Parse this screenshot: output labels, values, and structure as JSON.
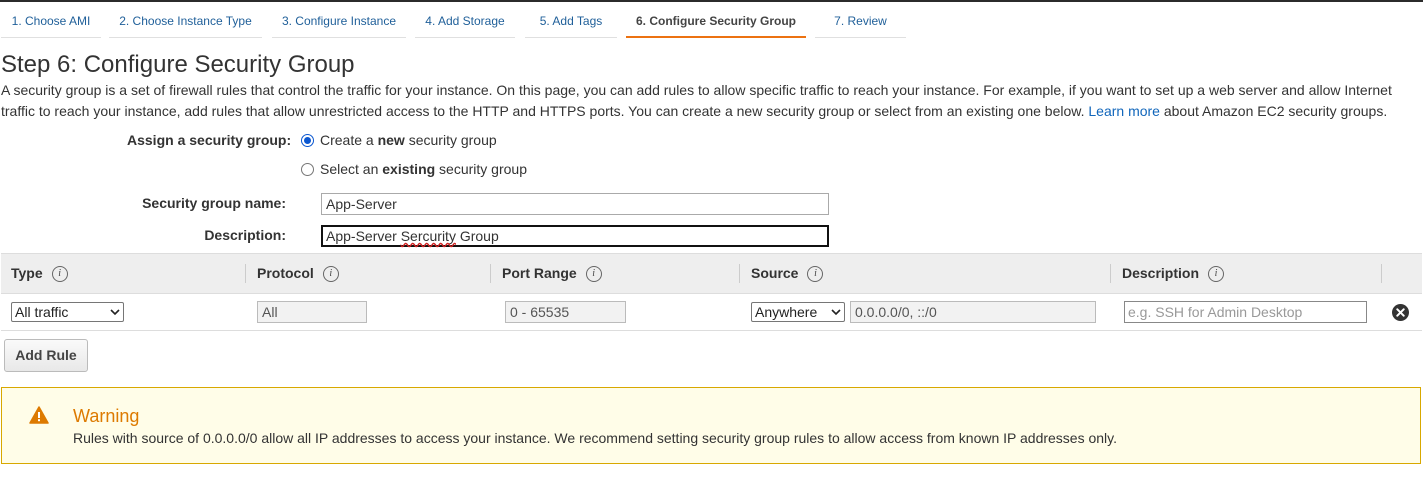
{
  "wizard_tabs": [
    {
      "label": "1. Choose AMI"
    },
    {
      "label": "2. Choose Instance Type"
    },
    {
      "label": "3. Configure Instance"
    },
    {
      "label": "4. Add Storage"
    },
    {
      "label": "5. Add Tags"
    },
    {
      "label": "6. Configure Security Group"
    },
    {
      "label": "7. Review"
    }
  ],
  "active_tab_index": 5,
  "page": {
    "title": "Step 6: Configure Security Group",
    "intro_text": "A security group is a set of firewall rules that control the traffic for your instance. On this page, you can add rules to allow specific traffic to reach your instance. For example, if you want to set up a web server and allow Internet traffic to reach your instance, add rules that allow unrestricted access to the HTTP and HTTPS ports. You can create a new security group or select from an existing one below.",
    "learn_more_link": "Learn more",
    "intro_suffix": "about Amazon EC2 security groups."
  },
  "assign": {
    "label": "Assign a security group:",
    "option_new_prefix": "Create a ",
    "option_new_bold": "new",
    "option_new_suffix": " security group",
    "option_existing_prefix": "Select an ",
    "option_existing_bold": "existing",
    "option_existing_suffix": " security group",
    "selected": "new"
  },
  "form": {
    "name_label": "Security group name:",
    "name_value": "App-Server",
    "description_label": "Description:",
    "description_value_start": "App-Server ",
    "description_value_misspelled": "Sercurity",
    "description_value_end": " Group"
  },
  "rules_table": {
    "headers": {
      "type": "Type",
      "protocol": "Protocol",
      "port_range": "Port Range",
      "source": "Source",
      "description": "Description"
    },
    "info_glyph": "i",
    "rows": [
      {
        "type": "All traffic",
        "protocol": "All",
        "port_range": "0 - 65535",
        "source_mode": "Anywhere",
        "source_cidr": "0.0.0.0/0, ::/0",
        "description_placeholder": "e.g. SSH for Admin Desktop"
      }
    ]
  },
  "add_rule_label": "Add Rule",
  "warning": {
    "title": "Warning",
    "text": "Rules with source of 0.0.0.0/0 allow all IP addresses to access your instance. We recommend setting security group rules to allow access from known IP addresses only."
  },
  "colors": {
    "link": "#1f5f99",
    "active_tab_underline": "#ec7211",
    "warning_title": "#dd7a00",
    "warning_border": "#d8a800",
    "warning_bg": "#fffde8"
  },
  "icons": {
    "info": "info-icon",
    "remove": "close-circle-icon",
    "warning": "warning-triangle-icon",
    "select_arrow": "chevron-down-icon"
  }
}
